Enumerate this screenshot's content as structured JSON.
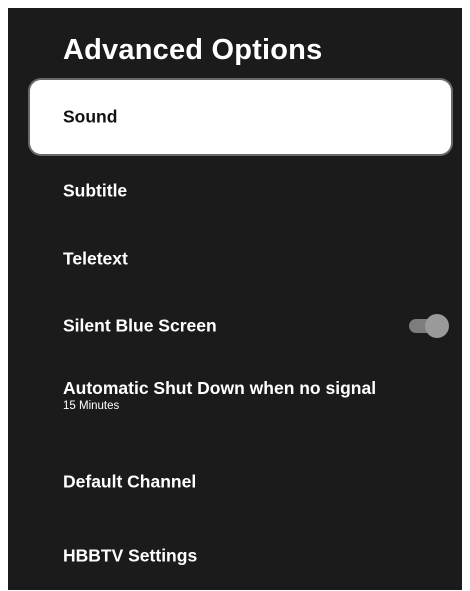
{
  "title": "Advanced Options",
  "menu": {
    "items": [
      {
        "label": "Sound",
        "selected": true
      },
      {
        "label": "Subtitle"
      },
      {
        "label": "Teletext"
      },
      {
        "label": "Silent Blue Screen",
        "toggle": {
          "state": "on"
        }
      },
      {
        "label": "Automatic Shut Down when no signal",
        "sublabel": "15 Minutes"
      },
      {
        "label": "Default Channel"
      },
      {
        "label": "HBBTV Settings"
      }
    ]
  },
  "colors": {
    "background": "#1b1b1b",
    "selected_background": "#ffffff",
    "text": "#ffffff",
    "selected_text": "#111111",
    "toggle_track": "#7d7d7d",
    "toggle_knob": "#9a9a9a"
  }
}
